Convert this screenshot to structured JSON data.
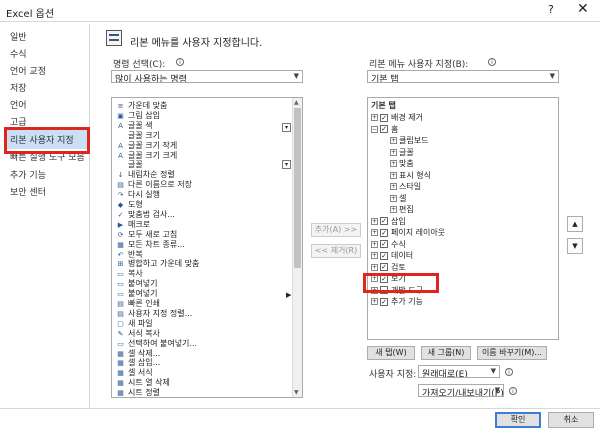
{
  "window": {
    "title": "Excel 옵션",
    "help_icon": "?",
    "close_icon": "✕"
  },
  "sidebar": {
    "items": [
      {
        "label": "일반"
      },
      {
        "label": "수식"
      },
      {
        "label": "언어 교정"
      },
      {
        "label": "저장"
      },
      {
        "label": "언어"
      },
      {
        "label": "고급"
      },
      {
        "label": "리본 사용자 지정"
      },
      {
        "label": "빠른 실행 도구 모음"
      },
      {
        "label": "추가 기능"
      },
      {
        "label": "보안 센터"
      }
    ],
    "active_index": 6
  },
  "main": {
    "heading": "리본 메뉴를 사용자 지정합니다.",
    "left": {
      "label": "명령 선택(C):",
      "combo_value": "많이 사용하는 명령",
      "commands": [
        {
          "icon": "≡",
          "label": "가운데 맞춤"
        },
        {
          "icon": "▣",
          "label": "그림 삽입"
        },
        {
          "icon": "A",
          "label": "글꼴 색"
        },
        {
          "icon": "",
          "label": "글꼴 크기"
        },
        {
          "icon": "A",
          "label": "글꼴 크기 작게"
        },
        {
          "icon": "A",
          "label": "글꼴 크기 크게"
        },
        {
          "icon": "",
          "label": "글꼴"
        },
        {
          "icon": "↓",
          "label": "내림차순 정렬"
        },
        {
          "icon": "▤",
          "label": "다른 이름으로 저장"
        },
        {
          "icon": "↷",
          "label": "다시 실행"
        },
        {
          "icon": "◆",
          "label": "도형"
        },
        {
          "icon": "✓",
          "label": "맞춤법 검사..."
        },
        {
          "icon": "▶",
          "label": "매크로"
        },
        {
          "icon": "⟳",
          "label": "모두 새로 고침"
        },
        {
          "icon": "▦",
          "label": "모든 차트 종류..."
        },
        {
          "icon": "↶",
          "label": "반복"
        },
        {
          "icon": "⊞",
          "label": "병합하고 가운데 맞춤"
        },
        {
          "icon": "▭",
          "label": "복사"
        },
        {
          "icon": "▭",
          "label": "붙여넣기"
        },
        {
          "icon": "▭",
          "label": "붙여넣기"
        },
        {
          "icon": "▤",
          "label": "빠른 인쇄"
        },
        {
          "icon": "▤",
          "label": "사용자 지정 정렬..."
        },
        {
          "icon": "▢",
          "label": "새 파일"
        },
        {
          "icon": "✎",
          "label": "서식 복사"
        },
        {
          "icon": "▭",
          "label": "선택하여 붙여넣기..."
        },
        {
          "icon": "▦",
          "label": "셀 삭제..."
        },
        {
          "icon": "▦",
          "label": "셀 삽입..."
        },
        {
          "icon": "▦",
          "label": "셀 서식"
        },
        {
          "icon": "▦",
          "label": "시트 열 삭제"
        },
        {
          "icon": "▦",
          "label": "시트 정렬"
        }
      ]
    },
    "mid": {
      "add_label": "추가(A) >>",
      "remove_label": "<< 제거(R)"
    },
    "right": {
      "label": "리본 메뉴 사용자 지정(B):",
      "combo_value": "기본 탭",
      "tree_header": "기본 탭",
      "tree": [
        {
          "level": 1,
          "exp": "+",
          "checked": true,
          "label": "배경 제거"
        },
        {
          "level": 1,
          "exp": "−",
          "checked": true,
          "label": "홈"
        },
        {
          "level": 2,
          "exp": "+",
          "checked": null,
          "label": "클립보드"
        },
        {
          "level": 2,
          "exp": "+",
          "checked": null,
          "label": "글꼴"
        },
        {
          "level": 2,
          "exp": "+",
          "checked": null,
          "label": "맞춤"
        },
        {
          "level": 2,
          "exp": "+",
          "checked": null,
          "label": "표시 형식"
        },
        {
          "level": 2,
          "exp": "+",
          "checked": null,
          "label": "스타일"
        },
        {
          "level": 2,
          "exp": "+",
          "checked": null,
          "label": "셀"
        },
        {
          "level": 2,
          "exp": "+",
          "checked": null,
          "label": "편집"
        },
        {
          "level": 1,
          "exp": "+",
          "checked": true,
          "label": "삽입"
        },
        {
          "level": 1,
          "exp": "+",
          "checked": true,
          "label": "페이지 레이아웃"
        },
        {
          "level": 1,
          "exp": "+",
          "checked": true,
          "label": "수식"
        },
        {
          "level": 1,
          "exp": "+",
          "checked": true,
          "label": "데이터"
        },
        {
          "level": 1,
          "exp": "+",
          "checked": true,
          "label": "검토"
        },
        {
          "level": 1,
          "exp": "+",
          "checked": true,
          "label": "보기"
        },
        {
          "level": 1,
          "exp": "+",
          "checked": false,
          "label": "개발 도구"
        },
        {
          "level": 1,
          "exp": "+",
          "checked": true,
          "label": "추가 기능"
        }
      ],
      "new_tab_label": "새 탭(W)",
      "new_group_label": "새 그룹(N)",
      "rename_label": "이름 바꾸기(M)...",
      "customize_label": "사용자 지정:",
      "reset_value": "원래대로(E)",
      "import_export_value": "가져오기/내보내기(P)"
    }
  },
  "footer": {
    "ok_label": "확인",
    "cancel_label": "취소"
  }
}
